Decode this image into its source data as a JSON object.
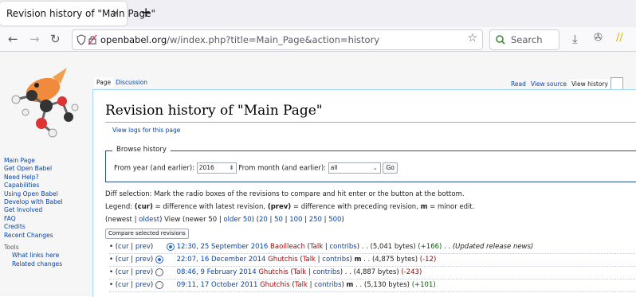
{
  "browser": {
    "tab_title": "Revision history of \"Main Page\"",
    "tab_close": "×",
    "new_tab": "+",
    "url_host": "openbabel.org",
    "url_path": "/w/index.php?title=Main_Page&action=history",
    "search_placeholder": "Search"
  },
  "tabs_left": [
    "Page",
    "Discussion"
  ],
  "tabs_right": [
    "Read",
    "View source",
    "View history"
  ],
  "sidebar": {
    "nav": [
      "Main Page",
      "Get Open Babel",
      "Need Help?",
      "Capabilities",
      "Using Open Babel",
      "Develop with Babel",
      "Get Involved",
      "FAQ",
      "Credits",
      "Recent Changes"
    ],
    "tools_heading": "Tools",
    "tools": [
      "What links here",
      "Related changes"
    ]
  },
  "content": {
    "title": "Revision history of \"Main Page\"",
    "view_logs": "View logs for this page",
    "browse": {
      "legend": "Browse history",
      "year_label": "From year (and earlier):",
      "year_value": "2016",
      "month_label": "From month (and earlier):",
      "month_value": "all",
      "go": "Go"
    },
    "diff_selection": "Diff selection: Mark the radio boxes of the revisions to compare and hit enter or the button at the bottom.",
    "legend_line": {
      "prefix": "Legend: ",
      "cur": "(cur)",
      "cur_desc": " = difference with latest revision, ",
      "prev": "(prev)",
      "prev_desc": " = difference with preceding revision, ",
      "m": "m",
      "m_desc": " = minor edit."
    },
    "nav": {
      "newest": "newest",
      "oldest": "oldest",
      "view": " View (newer 50 | ",
      "older": "older 50",
      "sizes": [
        "20",
        "50",
        "100",
        "250",
        "500"
      ]
    },
    "compare_button": "Compare selected revisions",
    "revisions": [
      {
        "cur": "cur",
        "prev": "prev",
        "date": "12:30, 25 September 2016",
        "user": "Baoilleach",
        "talk": "Talk",
        "contribs": "contribs",
        "minor": "",
        "bytes": "(5,041 bytes)",
        "diff": "(+166)",
        "summary": "(Updated release news)",
        "radio1": false,
        "radio2": true
      },
      {
        "cur": "cur",
        "prev": "prev",
        "date": "22:07, 16 December 2014",
        "user": "Ghutchis",
        "talk": "Talk",
        "contribs": "contribs",
        "minor": "m",
        "bytes": "(4,875 bytes)",
        "diff": "(-12)",
        "summary": "",
        "radio1": true,
        "radio2": false
      },
      {
        "cur": "cur",
        "prev": "prev",
        "date": "08:46, 9 February 2014",
        "user": "Ghutchis",
        "talk": "Talk",
        "contribs": "contribs",
        "minor": "",
        "bytes": "(4,887 bytes)",
        "diff": "(-243)",
        "summary": "",
        "radio1": false,
        "radio2": false
      },
      {
        "cur": "cur",
        "prev": "prev",
        "date": "09:11, 17 October 2011",
        "user": "Ghutchis",
        "talk": "Talk",
        "contribs": "contribs",
        "minor": "m",
        "bytes": "(5,130 bytes)",
        "diff": "(+101)",
        "summary": "",
        "radio1": false,
        "radio2": false
      }
    ]
  }
}
